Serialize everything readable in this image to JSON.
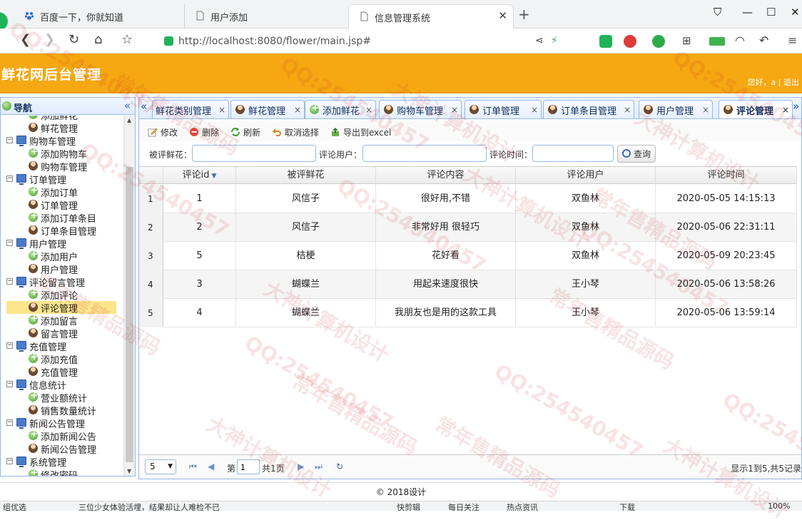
{
  "browser": {
    "tabs": [
      {
        "title": "百度一下，你就知道"
      },
      {
        "title": "用户添加"
      },
      {
        "title": "信息管理系统"
      }
    ],
    "url": "http://localhost:8080/flower/main.jsp#"
  },
  "header": {
    "title": "鲜花网后台管理",
    "greeting": "您好，a",
    "logout": "退出"
  },
  "nav": {
    "title": "导航",
    "tree": [
      {
        "type": "leaf",
        "label": "添加鲜花",
        "icon": "add"
      },
      {
        "type": "leaf",
        "label": "鲜花管理",
        "icon": "user"
      },
      {
        "type": "folder",
        "label": "购物车管理"
      },
      {
        "type": "leaf",
        "label": "添加购物车",
        "icon": "add"
      },
      {
        "type": "leaf",
        "label": "购物车管理",
        "icon": "user"
      },
      {
        "type": "folder",
        "label": "订单管理"
      },
      {
        "type": "leaf",
        "label": "添加订单",
        "icon": "add"
      },
      {
        "type": "leaf",
        "label": "订单管理",
        "icon": "user"
      },
      {
        "type": "leaf",
        "label": "添加订单条目",
        "icon": "add"
      },
      {
        "type": "leaf",
        "label": "订单条目管理",
        "icon": "user"
      },
      {
        "type": "folder",
        "label": "用户管理"
      },
      {
        "type": "leaf",
        "label": "添加用户",
        "icon": "add"
      },
      {
        "type": "leaf",
        "label": "用户管理",
        "icon": "user"
      },
      {
        "type": "folder",
        "label": "评论留言管理"
      },
      {
        "type": "leaf",
        "label": "添加评论",
        "icon": "add"
      },
      {
        "type": "leaf",
        "label": "评论管理",
        "icon": "user",
        "selected": true
      },
      {
        "type": "leaf",
        "label": "添加留言",
        "icon": "add"
      },
      {
        "type": "leaf",
        "label": "留言管理",
        "icon": "user"
      },
      {
        "type": "folder",
        "label": "充值管理"
      },
      {
        "type": "leaf",
        "label": "添加充值",
        "icon": "add"
      },
      {
        "type": "leaf",
        "label": "充值管理",
        "icon": "user"
      },
      {
        "type": "folder",
        "label": "信息统计"
      },
      {
        "type": "leaf",
        "label": "营业额统计",
        "icon": "add"
      },
      {
        "type": "leaf",
        "label": "销售数量统计",
        "icon": "user"
      },
      {
        "type": "folder",
        "label": "新闻公告管理"
      },
      {
        "type": "leaf",
        "label": "添加新闻公告",
        "icon": "add"
      },
      {
        "type": "leaf",
        "label": "新闻公告管理",
        "icon": "user"
      },
      {
        "type": "folder",
        "label": "系统管理"
      },
      {
        "type": "leaf",
        "label": "修改密码",
        "icon": "add"
      }
    ]
  },
  "panel_tabs": [
    {
      "label": "鲜花类别管理",
      "icon": "none"
    },
    {
      "label": "鲜花管理",
      "icon": "user"
    },
    {
      "label": "添加鲜花",
      "icon": "add"
    },
    {
      "label": "购物车管理",
      "icon": "user"
    },
    {
      "label": "订单管理",
      "icon": "user"
    },
    {
      "label": "订单条目管理",
      "icon": "user"
    },
    {
      "label": "用户管理",
      "icon": "user"
    },
    {
      "label": "评论管理",
      "icon": "user",
      "active": true
    }
  ],
  "toolbar": {
    "edit": "修改",
    "delete": "删除",
    "refresh": "刷新",
    "deselect": "取消选择",
    "export": "导出到excel"
  },
  "search": {
    "flower_label": "被评鲜花：",
    "user_label": "评论用户：",
    "time_label": "评论时间：",
    "flower_value": "",
    "user_value": "",
    "time_value": "",
    "query": "查询"
  },
  "grid": {
    "columns": [
      "评论id",
      "被评鲜花",
      "评论内容",
      "评论用户",
      "评论时间"
    ],
    "rows": [
      {
        "rn": "1",
        "id": "1",
        "flower": "风信子",
        "content": "很好用,不错",
        "user": "双鱼林",
        "time": "2020-05-05 14:15:13"
      },
      {
        "rn": "2",
        "id": "2",
        "flower": "风信子",
        "content": "非常好用 很轻巧",
        "user": "双鱼林",
        "time": "2020-05-06 22:31:11"
      },
      {
        "rn": "3",
        "id": "5",
        "flower": "桔梗",
        "content": "花好看",
        "user": "双鱼林",
        "time": "2020-05-09 20:23:45"
      },
      {
        "rn": "4",
        "id": "3",
        "flower": "蝴蝶兰",
        "content": "用起来速度很快",
        "user": "王小琴",
        "time": "2020-05-06 13:58:26"
      },
      {
        "rn": "5",
        "id": "4",
        "flower": "蝴蝶兰",
        "content": "我朋友也是用的这款工具",
        "user": "王小琴",
        "time": "2020-05-06 13:59:14"
      }
    ]
  },
  "pager": {
    "page_size": "5",
    "page_prefix": "第",
    "page_value": "1",
    "page_total": "共1页",
    "info": "显示1到5,共5记录"
  },
  "footer": "© 2018设计",
  "statusbar": [
    "组优选",
    "三位少女体验活埋，结果却让人难检不已",
    "快剪辑",
    "每日关注",
    "热点资讯",
    "下载",
    "100%"
  ],
  "watermark": [
    "QQ:254540457",
    "大神计算机设计",
    "常年售精品源码"
  ]
}
